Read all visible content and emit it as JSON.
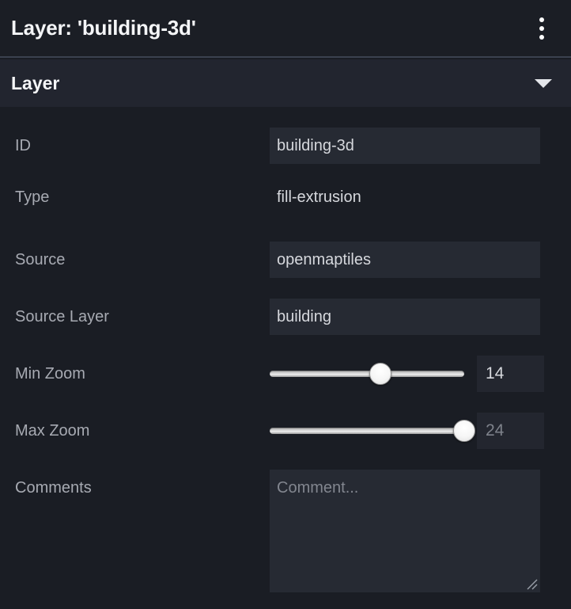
{
  "titlebar": {
    "title": "Layer: 'building-3d'",
    "menu_icon": "kebab-menu-icon"
  },
  "accordion": {
    "label": "Layer",
    "chevron_icon": "chevron-down-icon",
    "expanded": true
  },
  "fields": {
    "id": {
      "label": "ID",
      "value": "building-3d",
      "placeholder": ""
    },
    "type": {
      "label": "Type",
      "value": "fill-extrusion"
    },
    "source": {
      "label": "Source",
      "value": "openmaptiles",
      "placeholder": ""
    },
    "source_layer": {
      "label": "Source Layer",
      "value": "building",
      "placeholder": ""
    },
    "min_zoom": {
      "label": "Min Zoom",
      "value": "14",
      "placeholder": "",
      "slider_percent": 57,
      "min": 0,
      "max": 24
    },
    "max_zoom": {
      "label": "Max Zoom",
      "value": "",
      "placeholder": "24",
      "slider_percent": 100,
      "min": 0,
      "max": 24
    },
    "comments": {
      "label": "Comments",
      "value": "",
      "placeholder": "Comment..."
    }
  },
  "colors": {
    "background": "#1a1d24",
    "titlebar_bg": "#1b1e25",
    "accordion_bg": "#22252f",
    "input_bg": "#262a33",
    "label_text": "#a7aab2",
    "value_text": "#d6d8dd",
    "placeholder_text": "#7e828b",
    "divider": "#3b414f"
  }
}
